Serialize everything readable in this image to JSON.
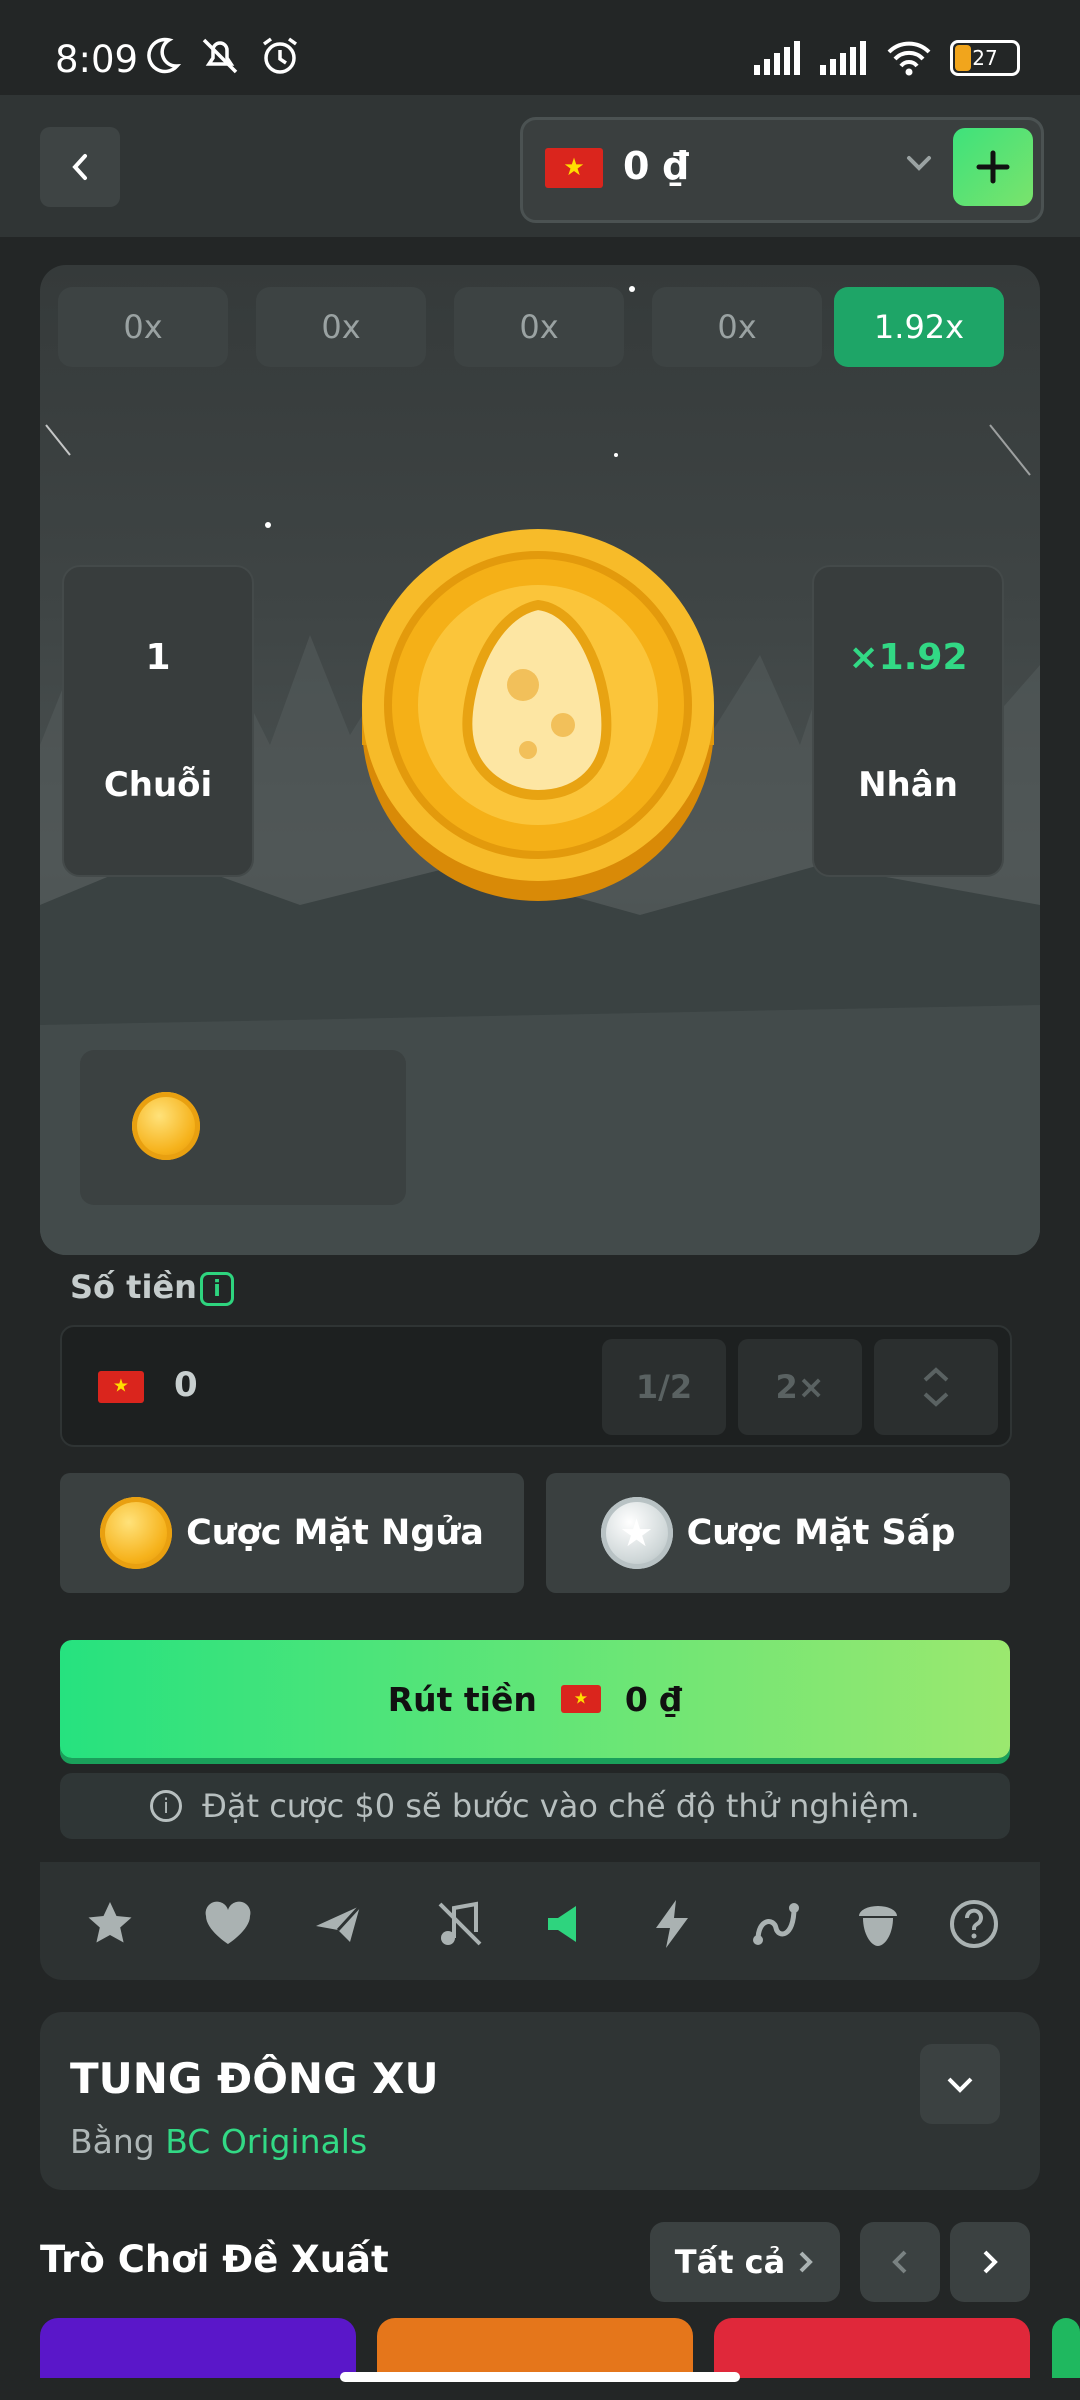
{
  "status_bar": {
    "time": "8:09",
    "battery": "27"
  },
  "header": {
    "balance": "0 ₫"
  },
  "game": {
    "history": [
      "0x",
      "0x",
      "0x",
      "0x",
      "1.92x"
    ],
    "streak": {
      "value": "1",
      "label": "Chuỗi"
    },
    "multiplier": {
      "value": "×1.92",
      "label": "Nhân"
    }
  },
  "bet": {
    "amount_label": "Số tiền",
    "amount_value": "0",
    "half_label": "1/2",
    "double_label": "2×",
    "heads_label": "Cược Mặt Ngửa",
    "tails_label": "Cược Mặt Sấp",
    "cashout_label": "Rút tiền",
    "cashout_amount": "0 ₫",
    "notice": "Đặt cược $0 sẽ bước vào chế độ thử nghiệm."
  },
  "game_info": {
    "title": "TUNG ĐÔNG XU",
    "by_prefix": "Bằng",
    "by_name": "BC Originals"
  },
  "recommended": {
    "title": "Trò Chơi Đề Xuất",
    "all_label": "Tất cả",
    "thumb_colors": [
      "#5a17c9",
      "#e5761b",
      "#e0283a",
      "#1fb85f"
    ]
  },
  "colors": {
    "accent": "#1ea567",
    "green_text": "#32d985",
    "bg": "#232626"
  }
}
